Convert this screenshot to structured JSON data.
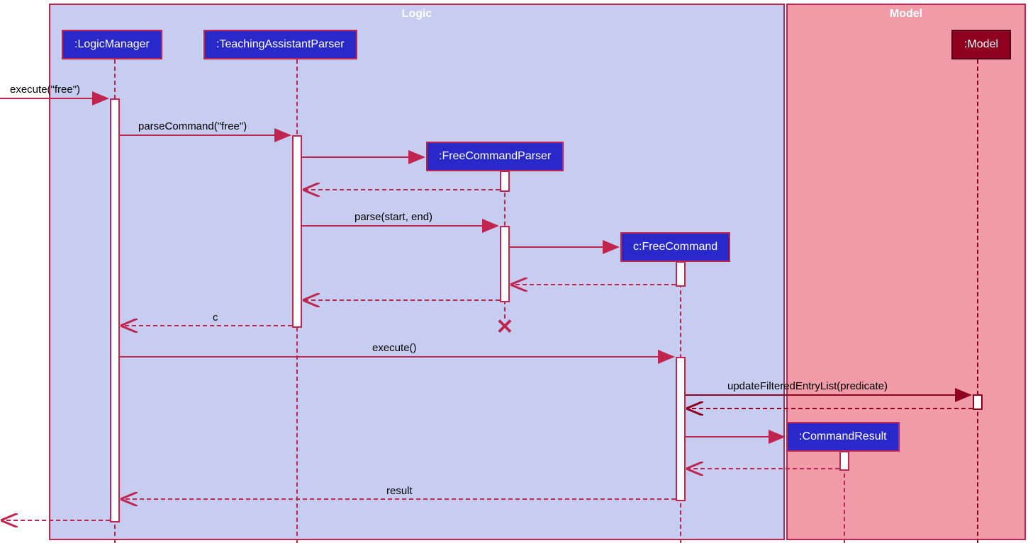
{
  "packages": {
    "logic": {
      "title": "Logic"
    },
    "model": {
      "title": "Model"
    }
  },
  "participants": {
    "logicManager": {
      "label": ":LogicManager"
    },
    "taParser": {
      "label": ":TeachingAssistantParser"
    },
    "freeCmdParser": {
      "label": ":FreeCommandParser"
    },
    "freeCmd": {
      "label": "c:FreeCommand"
    },
    "cmdResult": {
      "label": ":CommandResult"
    },
    "model": {
      "label": ":Model"
    }
  },
  "messages": {
    "m1": "execute(\"free\")",
    "m2": "parseCommand(\"free\")",
    "m3": "parse(start, end)",
    "m4": "c",
    "m5": "execute()",
    "m6": "updateFilteredEntryList(predicate)",
    "m7": "result"
  },
  "chart_data": {
    "type": "sequence_diagram",
    "packages": [
      {
        "name": "Logic",
        "participants": [
          ":LogicManager",
          ":TeachingAssistantParser",
          ":FreeCommandParser",
          "c:FreeCommand",
          ":CommandResult"
        ]
      },
      {
        "name": "Model",
        "participants": [
          ":Model"
        ]
      }
    ],
    "participants": [
      {
        "id": "LogicManager",
        "label": ":LogicManager",
        "created_at_start": true
      },
      {
        "id": "TeachingAssistantParser",
        "label": ":TeachingAssistantParser",
        "created_at_start": true
      },
      {
        "id": "FreeCommandParser",
        "label": ":FreeCommandParser",
        "created_at_start": false,
        "destroyed": true
      },
      {
        "id": "FreeCommand",
        "label": "c:FreeCommand",
        "created_at_start": false
      },
      {
        "id": "CommandResult",
        "label": ":CommandResult",
        "created_at_start": false
      },
      {
        "id": "Model",
        "label": ":Model",
        "created_at_start": true
      }
    ],
    "messages": [
      {
        "from": "external",
        "to": "LogicManager",
        "label": "execute(\"free\")",
        "type": "call"
      },
      {
        "from": "LogicManager",
        "to": "TeachingAssistantParser",
        "label": "parseCommand(\"free\")",
        "type": "call"
      },
      {
        "from": "TeachingAssistantParser",
        "to": "FreeCommandParser",
        "label": "",
        "type": "create"
      },
      {
        "from": "FreeCommandParser",
        "to": "TeachingAssistantParser",
        "label": "",
        "type": "return"
      },
      {
        "from": "TeachingAssistantParser",
        "to": "FreeCommandParser",
        "label": "parse(start, end)",
        "type": "call"
      },
      {
        "from": "FreeCommandParser",
        "to": "FreeCommand",
        "label": "",
        "type": "create"
      },
      {
        "from": "FreeCommand",
        "to": "FreeCommandParser",
        "label": "",
        "type": "return"
      },
      {
        "from": "FreeCommandParser",
        "to": "TeachingAssistantParser",
        "label": "",
        "type": "return"
      },
      {
        "from": "TeachingAssistantParser",
        "to": "LogicManager",
        "label": "c",
        "type": "return"
      },
      {
        "note": "FreeCommandParser destroyed",
        "type": "destroy",
        "target": "FreeCommandParser"
      },
      {
        "from": "LogicManager",
        "to": "FreeCommand",
        "label": "execute()",
        "type": "call"
      },
      {
        "from": "FreeCommand",
        "to": "Model",
        "label": "updateFilteredEntryList(predicate)",
        "type": "call"
      },
      {
        "from": "Model",
        "to": "FreeCommand",
        "label": "",
        "type": "return"
      },
      {
        "from": "FreeCommand",
        "to": "CommandResult",
        "label": "",
        "type": "create"
      },
      {
        "from": "CommandResult",
        "to": "FreeCommand",
        "label": "",
        "type": "return"
      },
      {
        "from": "FreeCommand",
        "to": "LogicManager",
        "label": "result",
        "type": "return"
      },
      {
        "from": "LogicManager",
        "to": "external",
        "label": "",
        "type": "return"
      }
    ]
  }
}
